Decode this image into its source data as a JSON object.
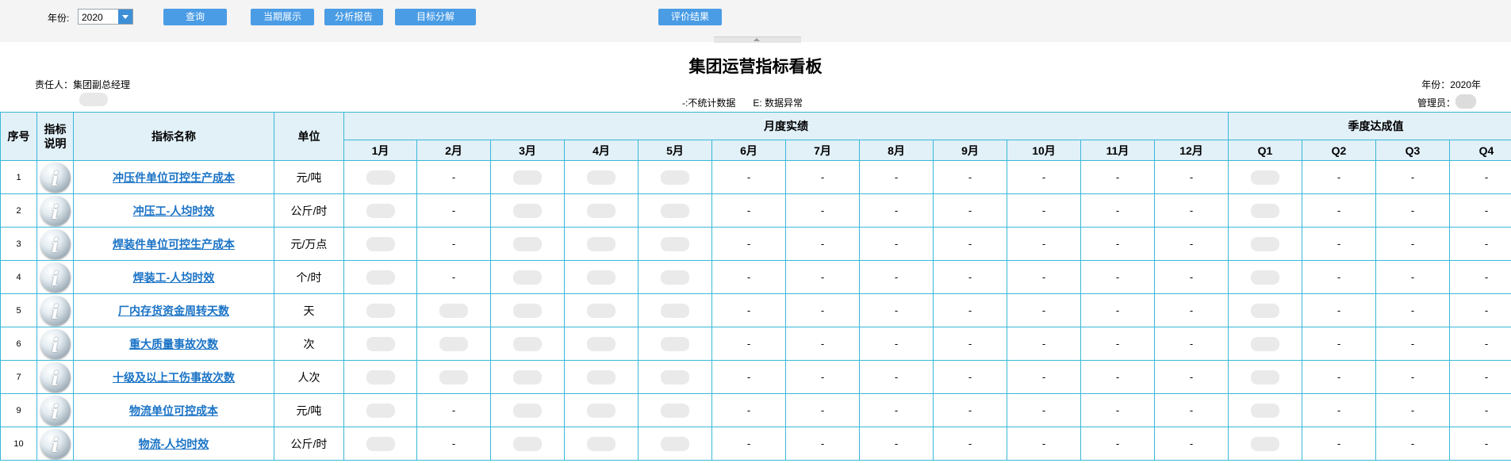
{
  "toolbar": {
    "year_label": "年份:",
    "year_value": "2020",
    "buttons": [
      "查询",
      "当期展示",
      "分析报告",
      "目标分解",
      "评价结果"
    ]
  },
  "header": {
    "title": "集团运营指标看板",
    "responsible": "责任人：集团副总经理",
    "year_text": "年份：2020年",
    "legend_dash": "-:不统计数据",
    "legend_e": "E: 数据异常",
    "admin_label": "管理员："
  },
  "table": {
    "headers": {
      "index": "序号",
      "desc": "指标说明",
      "name": "指标名称",
      "unit": "单位",
      "monthly": "月度实绩",
      "quarterly": "季度达成值"
    },
    "months": [
      "1月",
      "2月",
      "3月",
      "4月",
      "5月",
      "6月",
      "7月",
      "8月",
      "9月",
      "10月",
      "11月",
      "12月"
    ],
    "quarters": [
      "Q1",
      "Q2",
      "Q3",
      "Q4"
    ],
    "rows": [
      {
        "idx": "1",
        "name": "冲压件单位可控生产成本",
        "unit": "元/吨",
        "months": [
          "",
          "-",
          "",
          "",
          "",
          "-",
          "-",
          "-",
          "-",
          "-",
          "-",
          "-"
        ],
        "quarters": [
          "",
          "-",
          "-",
          "-"
        ]
      },
      {
        "idx": "2",
        "name": "冲压工-人均时效",
        "unit": "公斤/时",
        "months": [
          "",
          "-",
          "",
          "",
          "",
          "-",
          "-",
          "-",
          "-",
          "-",
          "-",
          "-"
        ],
        "quarters": [
          "",
          "-",
          "-",
          "-"
        ]
      },
      {
        "idx": "3",
        "name": "焊装件单位可控生产成本",
        "unit": "元/万点",
        "months": [
          "",
          "-",
          "",
          "",
          "",
          "-",
          "-",
          "-",
          "-",
          "-",
          "-",
          "-"
        ],
        "quarters": [
          "",
          "-",
          "-",
          "-"
        ]
      },
      {
        "idx": "4",
        "name": "焊装工-人均时效",
        "unit": "个/时",
        "months": [
          "",
          "-",
          "",
          "",
          "",
          "-",
          "-",
          "-",
          "-",
          "-",
          "-",
          "-"
        ],
        "quarters": [
          "",
          "-",
          "-",
          "-"
        ]
      },
      {
        "idx": "5",
        "name": "厂内存货资金周转天数",
        "unit": "天",
        "months": [
          "",
          "",
          "",
          "",
          "",
          "-",
          "-",
          "-",
          "-",
          "-",
          "-",
          "-"
        ],
        "quarters": [
          "",
          "-",
          "-",
          "-"
        ]
      },
      {
        "idx": "6",
        "name": "重大质量事故次数",
        "unit": "次",
        "months": [
          "",
          "",
          "",
          "",
          "",
          "-",
          "-",
          "-",
          "-",
          "-",
          "-",
          "-"
        ],
        "quarters": [
          "",
          "-",
          "-",
          "-"
        ]
      },
      {
        "idx": "7",
        "name": "十级及以上工伤事故次数",
        "unit": "人次",
        "months": [
          "",
          "",
          "",
          "",
          "",
          "-",
          "-",
          "-",
          "-",
          "-",
          "-",
          "-"
        ],
        "quarters": [
          "",
          "-",
          "-",
          "-"
        ]
      },
      {
        "idx": "9",
        "name": "物流单位可控成本",
        "unit": "元/吨",
        "months": [
          "",
          "-",
          "",
          "",
          "",
          "-",
          "-",
          "-",
          "-",
          "-",
          "-",
          "-"
        ],
        "quarters": [
          "",
          "-",
          "-",
          "-"
        ]
      },
      {
        "idx": "10",
        "name": "物流-人均时效",
        "unit": "公斤/时",
        "months": [
          "",
          "-",
          "",
          "",
          "",
          "-",
          "-",
          "-",
          "-",
          "-",
          "-",
          "-"
        ],
        "quarters": [
          "",
          "-",
          "-",
          "-"
        ]
      }
    ]
  }
}
